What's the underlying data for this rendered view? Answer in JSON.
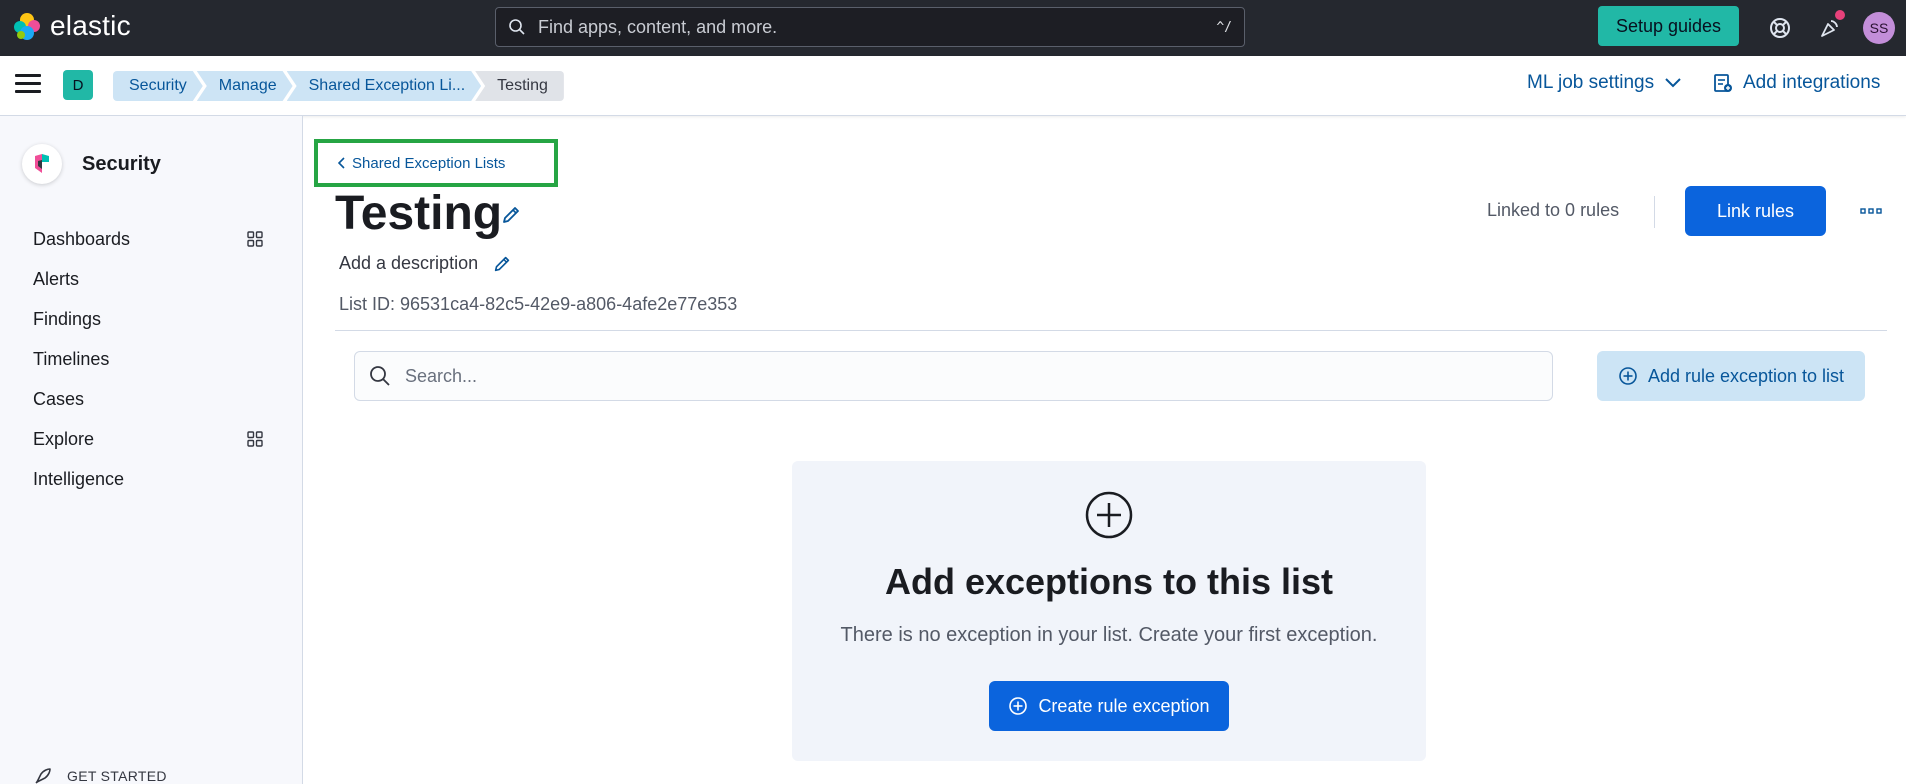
{
  "header": {
    "brand": "elastic",
    "search_placeholder": "Find apps, content, and more.",
    "search_shortcut": "^/",
    "setup_guides": "Setup guides",
    "user_initials": "SS"
  },
  "subbar": {
    "space_initial": "D",
    "breadcrumbs": [
      "Security",
      "Manage",
      "Shared Exception Li...",
      "Testing"
    ],
    "ml_job_settings": "ML job settings",
    "add_integrations": "Add integrations"
  },
  "sidebar": {
    "title": "Security",
    "items": [
      {
        "label": "Dashboards",
        "has_grid_icon": true
      },
      {
        "label": "Alerts",
        "has_grid_icon": false
      },
      {
        "label": "Findings",
        "has_grid_icon": false
      },
      {
        "label": "Timelines",
        "has_grid_icon": false
      },
      {
        "label": "Cases",
        "has_grid_icon": false
      },
      {
        "label": "Explore",
        "has_grid_icon": true
      },
      {
        "label": "Intelligence",
        "has_grid_icon": false
      }
    ],
    "get_started": "GET STARTED"
  },
  "page": {
    "back_link": "Shared Exception Lists",
    "title": "Testing",
    "description_placeholder": "Add a description",
    "list_id": "List ID: 96531ca4-82c5-42e9-a806-4afe2e77e353",
    "linked_rules": "Linked to 0 rules",
    "link_rules_button": "Link rules",
    "search_placeholder": "Search...",
    "add_rule_exception_button": "Add rule exception to list"
  },
  "empty_state": {
    "title": "Add exceptions to this list",
    "body": "There is no exception in your list. Create your first exception.",
    "button": "Create rule exception"
  },
  "colors": {
    "header_bg": "#25282f",
    "accent_teal": "#21b8a6",
    "primary_blue": "#0b64dd",
    "link_blue": "#07569a",
    "highlight_green": "#26a544"
  }
}
